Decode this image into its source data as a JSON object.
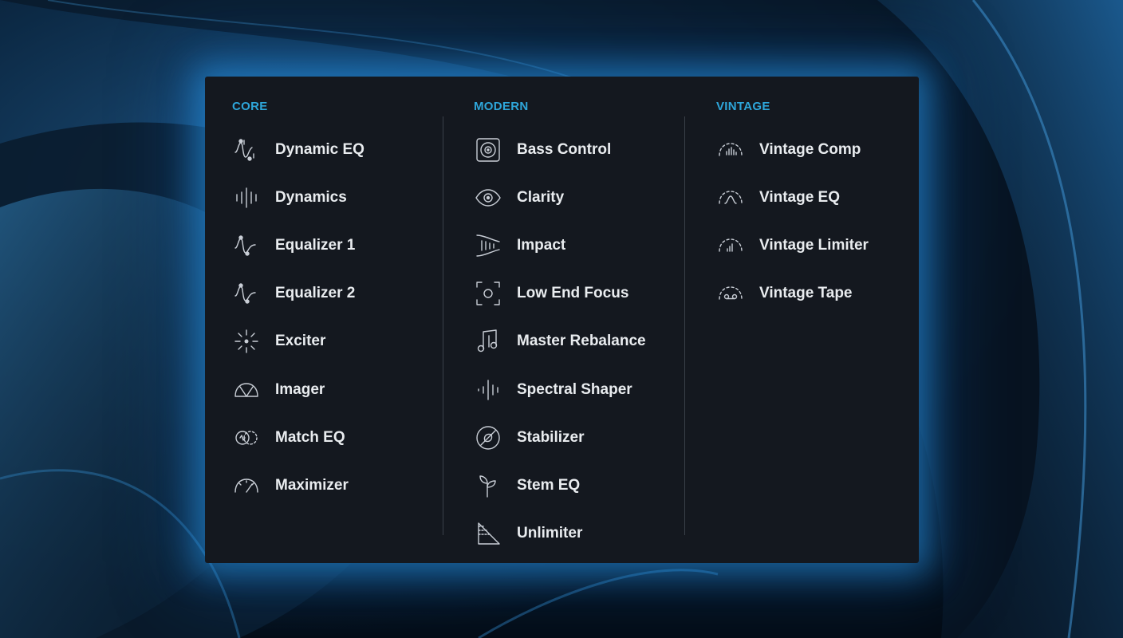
{
  "columns": [
    {
      "heading": "CORE",
      "items": [
        {
          "label": "Dynamic EQ",
          "icon": "dynamic-eq-icon"
        },
        {
          "label": "Dynamics",
          "icon": "dynamics-icon"
        },
        {
          "label": "Equalizer 1",
          "icon": "equalizer-icon"
        },
        {
          "label": "Equalizer 2",
          "icon": "equalizer-icon"
        },
        {
          "label": "Exciter",
          "icon": "exciter-icon"
        },
        {
          "label": "Imager",
          "icon": "imager-icon"
        },
        {
          "label": "Match EQ",
          "icon": "match-eq-icon"
        },
        {
          "label": "Maximizer",
          "icon": "maximizer-icon"
        }
      ]
    },
    {
      "heading": "MODERN",
      "items": [
        {
          "label": "Bass Control",
          "icon": "speaker-icon"
        },
        {
          "label": "Clarity",
          "icon": "eye-icon"
        },
        {
          "label": "Impact",
          "icon": "impact-icon"
        },
        {
          "label": "Low End Focus",
          "icon": "focus-icon"
        },
        {
          "label": "Master Rebalance",
          "icon": "music-note-icon"
        },
        {
          "label": "Spectral Shaper",
          "icon": "spectral-shaper-icon"
        },
        {
          "label": "Stabilizer",
          "icon": "stabilizer-icon"
        },
        {
          "label": "Stem EQ",
          "icon": "sprout-icon"
        },
        {
          "label": "Unlimiter",
          "icon": "unlimiter-icon"
        }
      ]
    },
    {
      "heading": "VINTAGE",
      "items": [
        {
          "label": "Vintage Comp",
          "icon": "vintage-comp-icon"
        },
        {
          "label": "Vintage EQ",
          "icon": "vintage-eq-icon"
        },
        {
          "label": "Vintage Limiter",
          "icon": "vintage-limiter-icon"
        },
        {
          "label": "Vintage Tape",
          "icon": "vintage-tape-icon"
        }
      ]
    }
  ],
  "colors": {
    "heading": "#2ea6da",
    "panel": "#14181f",
    "label": "#e9ecef",
    "glow": "#2896e6"
  }
}
